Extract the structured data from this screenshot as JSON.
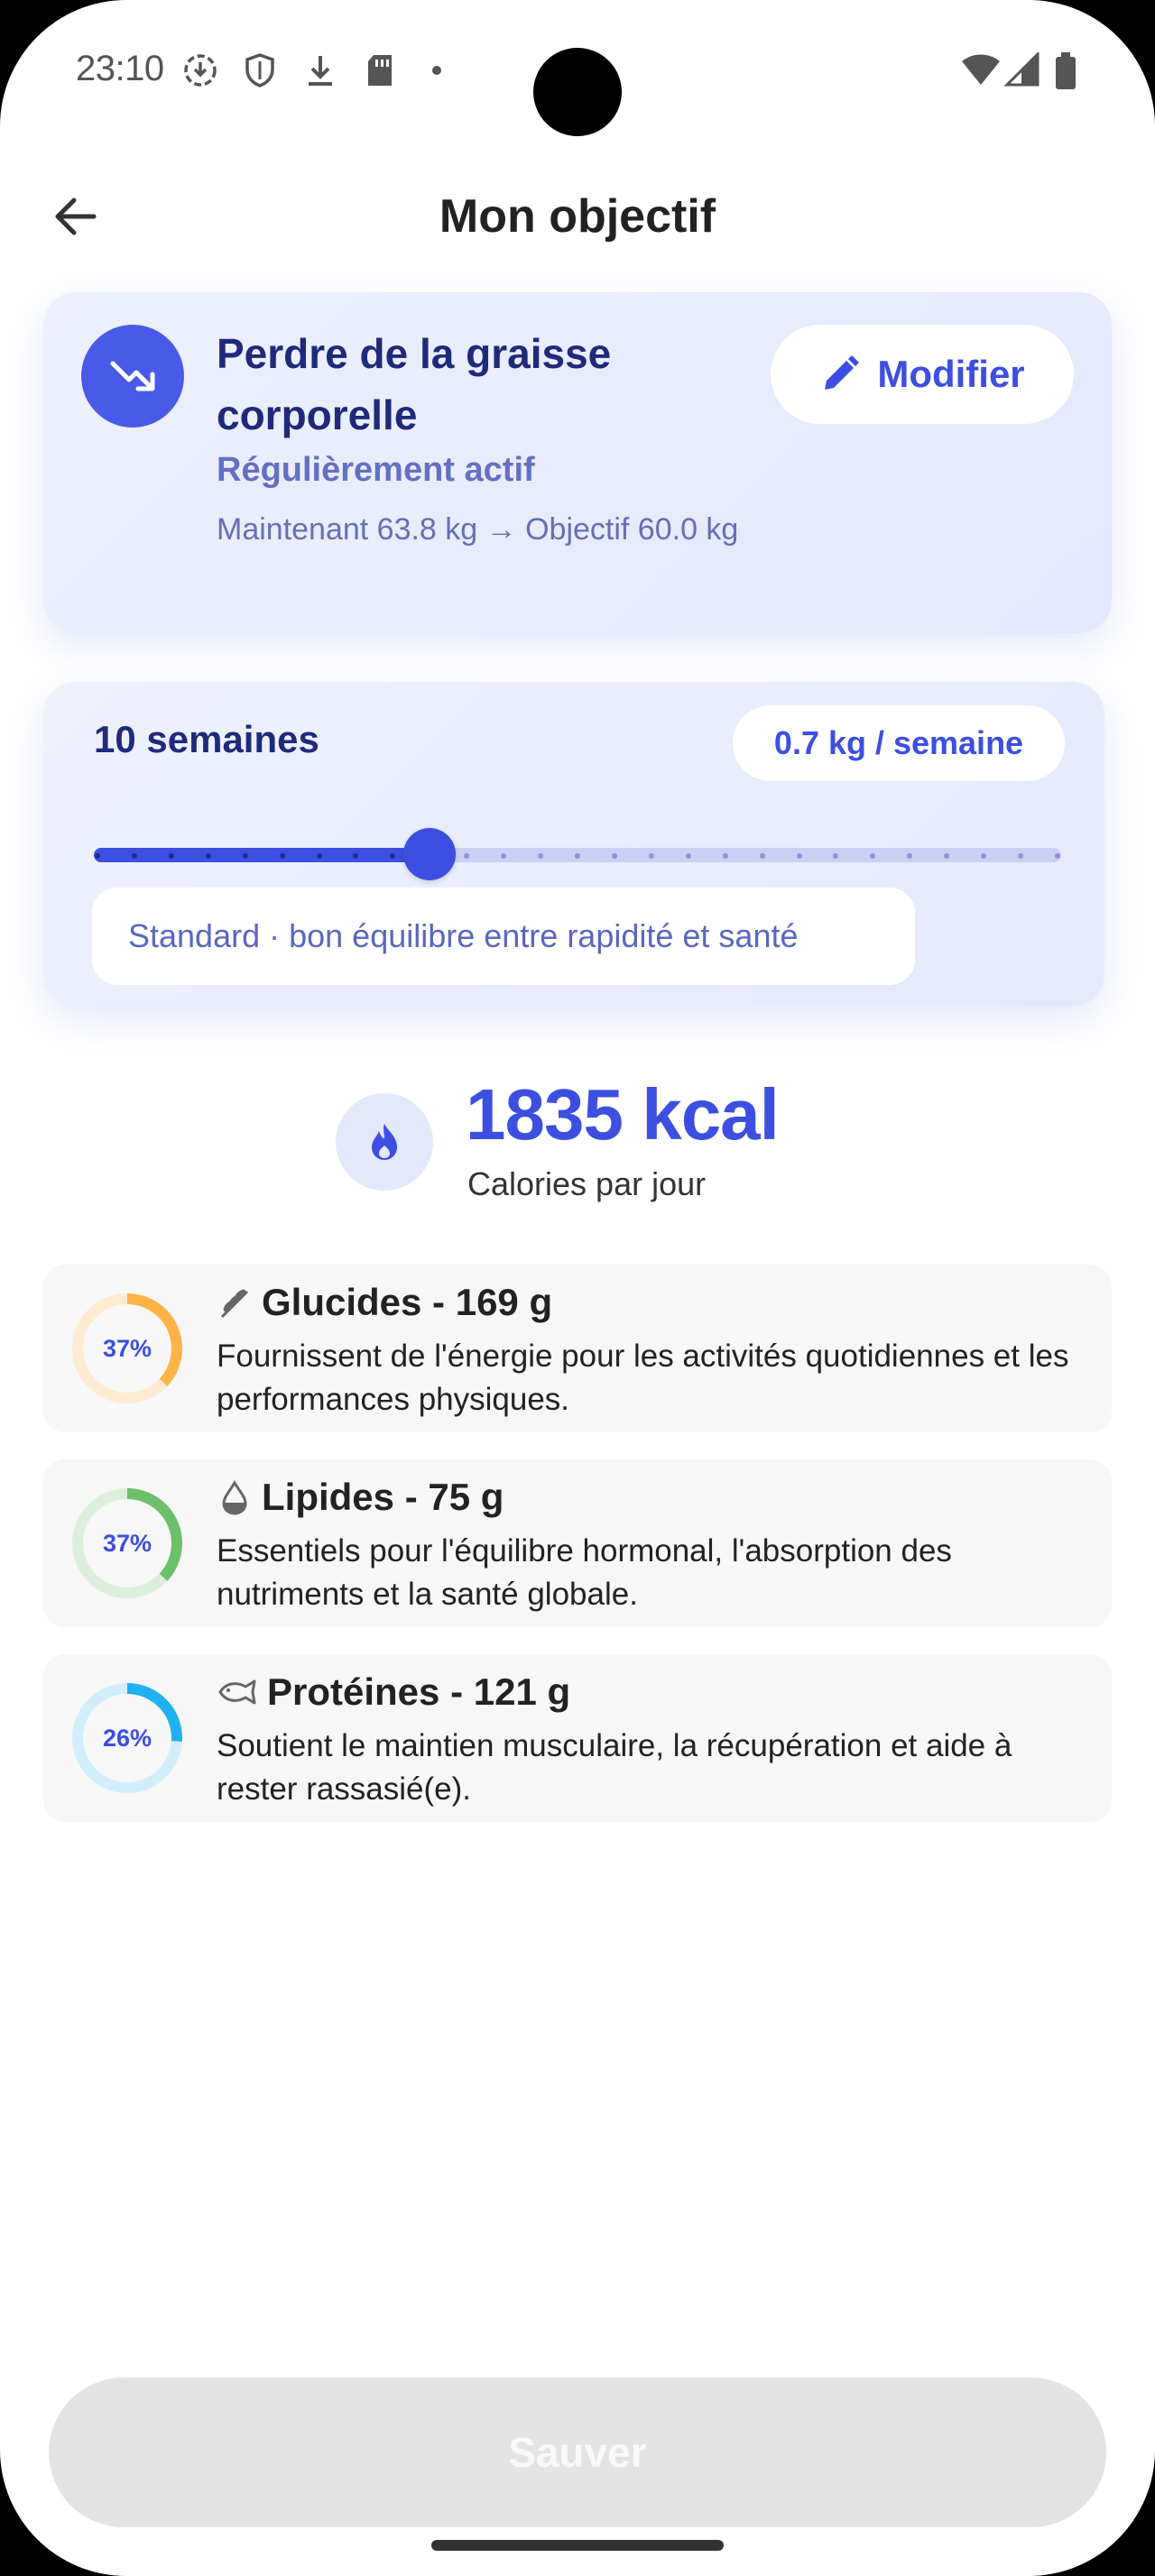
{
  "status_bar": {
    "time": "23:10"
  },
  "app_bar": {
    "title": "Mon objectif"
  },
  "goal": {
    "title": "Perdre de la graisse corporelle",
    "activity_level": "Régulièrement actif",
    "weights": "Maintenant 63.8 kg  →  Objectif 60.0 kg",
    "modify_label": "Modifier"
  },
  "duration": {
    "label": "10 semaines",
    "rate": "0.7 kg / semaine",
    "slider": {
      "min": 1,
      "max": 27,
      "value": 10
    },
    "note": "Standard · bon équilibre entre rapidité et santé"
  },
  "calories": {
    "value": "1835 kcal",
    "label": "Calories par jour"
  },
  "macros": [
    {
      "title": "Glucides - 169 g",
      "percent_label": "37%",
      "percent": 37,
      "description": "Fournissent de l'énergie pour les activités quotidiennes et les performances physiques.",
      "color": "#ffb347",
      "track_color": "#fcead2",
      "icon": "wheat-icon"
    },
    {
      "title": "Lipides - 75 g",
      "percent_label": "37%",
      "percent": 37,
      "description": "Essentiels pour l'équilibre hormonal, l'absorption des nutriments et la santé globale.",
      "color": "#6cc06a",
      "track_color": "#dcefdc",
      "icon": "oil-drop-icon"
    },
    {
      "title": "Protéines - 121 g",
      "percent_label": "26%",
      "percent": 26,
      "description": "Soutient le maintien musculaire, la récupération et aide à rester rassasié(e).",
      "color": "#1fb1f2",
      "track_color": "#d2eefb",
      "icon": "fish-icon"
    }
  ],
  "save_label": "Sauver",
  "colors": {
    "accent": "#3d4fe0",
    "navy": "#1f2a7a"
  }
}
